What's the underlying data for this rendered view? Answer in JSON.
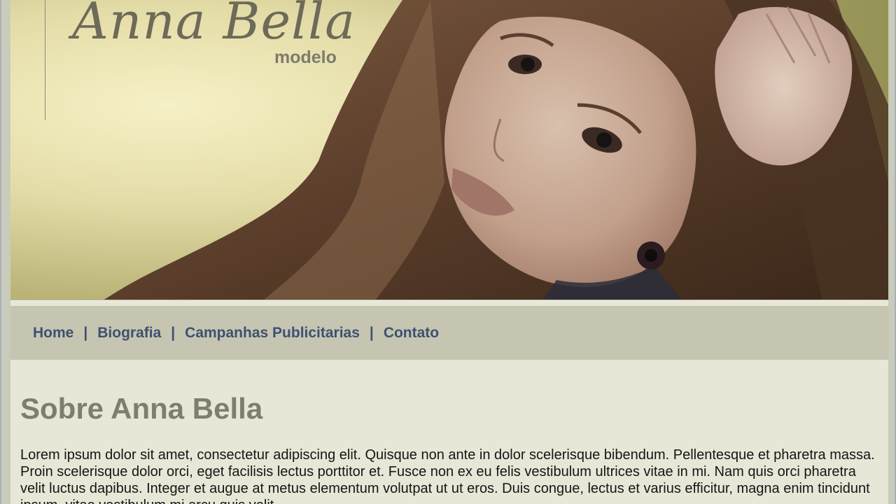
{
  "brand": {
    "name": "Anna Bella",
    "subtitle": "modelo"
  },
  "nav": {
    "items": [
      {
        "label": "Home"
      },
      {
        "label": "Biografia"
      },
      {
        "label": "Campanhas Publicitarias"
      },
      {
        "label": "Contato"
      }
    ],
    "separator": "|"
  },
  "main": {
    "heading": "Sobre Anna Bella",
    "paragraph": "Lorem ipsum dolor sit amet, consectetur adipiscing elit. Quisque non ante in dolor scelerisque bibendum. Pellentesque et pharetra massa. Proin scelerisque dolor orci, eget facilisis lectus porttitor et. Fusce non ex eu felis vestibulum ultrices vitae in mi. Nam quis orci pharetra velit luctus dapibus. Integer et augue at metus elementum volutpat ut ut eros. Duis congue, lectus et varius efficitur, magna enim tincidunt ipsum, vitae vestibulum mi arcu quis velit."
  },
  "colors": {
    "nav_background": "#c5c5b1",
    "nav_link": "#3f5071",
    "page_background": "#e7e7d8",
    "heading": "#7f7e6c"
  }
}
